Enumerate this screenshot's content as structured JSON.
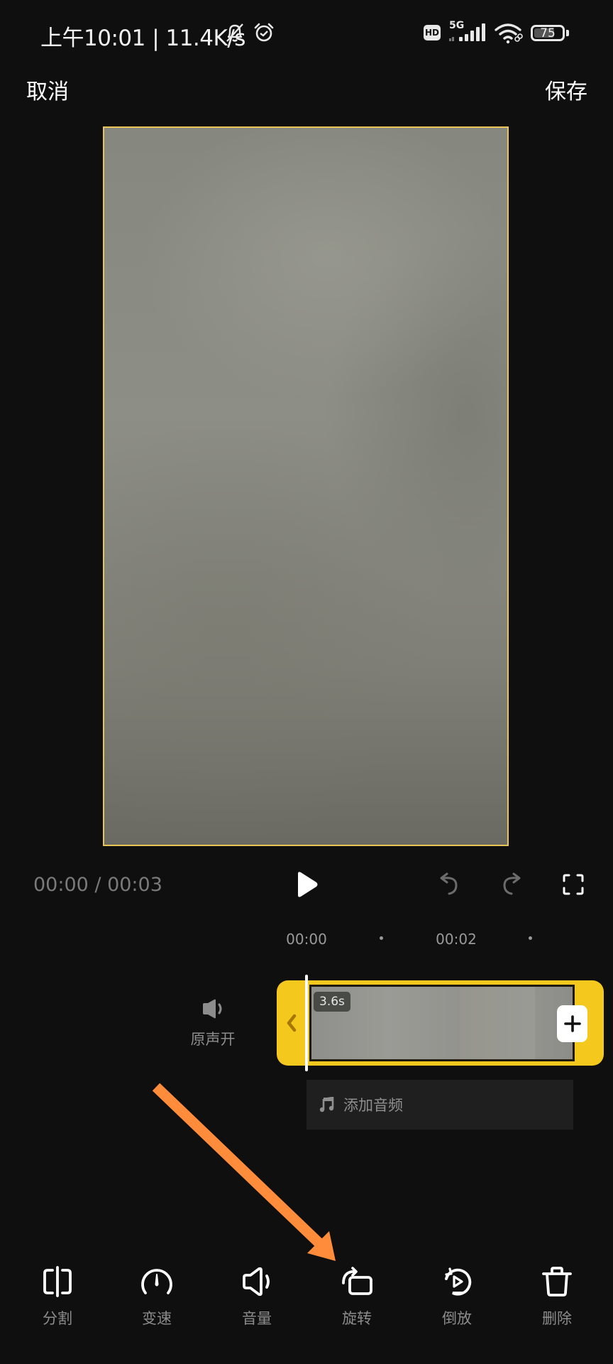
{
  "status_bar": {
    "time_and_speed": "上午10:01 | 11.4K/s",
    "icons": [
      "mute-bell-icon",
      "alarm-clock-icon",
      "hd-icon",
      "5g-signal-icon",
      "wifi-icon",
      "battery-icon"
    ],
    "hd_label": "HD",
    "network_label": "5G",
    "battery_level": "75",
    "battery_percent": 75
  },
  "header": {
    "cancel_label": "取消",
    "save_label": "保存"
  },
  "player": {
    "current_time": "00:00",
    "total_time": "00:03",
    "time_readout": "00:00 / 00:03",
    "controls": [
      "play-icon",
      "undo-icon",
      "redo-icon",
      "fullscreen-icon"
    ]
  },
  "timeline": {
    "ruler_labels": [
      "00:00",
      "00:02"
    ],
    "clip_duration": "3.6s",
    "original_audio_label": "原声开",
    "add_audio_label": "添加音频"
  },
  "toolbar": {
    "items": [
      {
        "label": "分割",
        "icon": "split-icon"
      },
      {
        "label": "变速",
        "icon": "speed-icon"
      },
      {
        "label": "音量",
        "icon": "volume-icon"
      },
      {
        "label": "旋转",
        "icon": "rotate-icon"
      },
      {
        "label": "倒放",
        "icon": "reverse-icon"
      },
      {
        "label": "删除",
        "icon": "delete-icon"
      }
    ]
  },
  "annotation": {
    "arrow_color": "#ff8c3a",
    "points_to": "旋转"
  },
  "colors": {
    "accent": "#f4c81d",
    "background": "#0f0f0f",
    "label_gray": "#8c8c8c"
  }
}
